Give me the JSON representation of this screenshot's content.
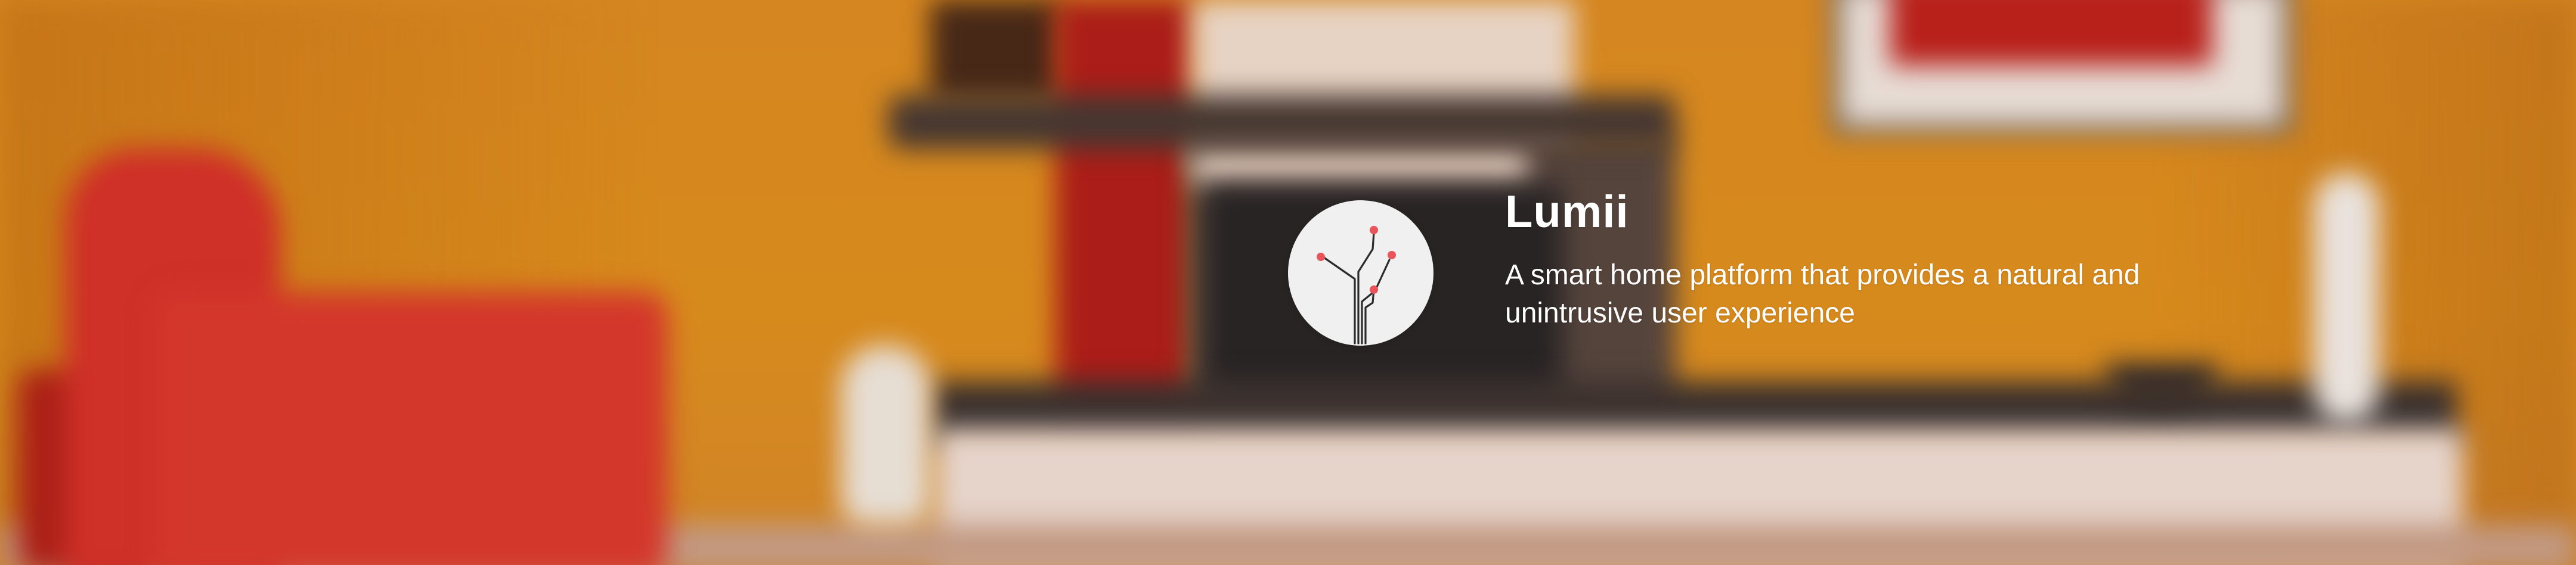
{
  "brand": {
    "name": "Lumii",
    "tagline": "A smart home platform that provides a natural and unintrusive user experience",
    "logo_icon": "circuit-tree-icon"
  },
  "colors": {
    "logo_background": "#f0f0f0",
    "logo_lines": "#2b2b2b",
    "logo_nodes": "#e8545a",
    "text": "#ffffff",
    "wall": "#e08a1c",
    "accent_red": "#d8322a"
  },
  "background": {
    "description_icon": "blurred-living-room-background"
  }
}
